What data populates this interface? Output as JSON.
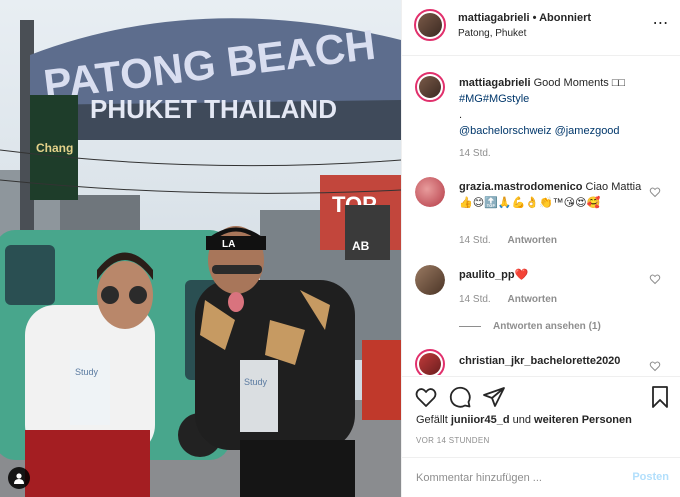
{
  "photo": {
    "sign_line1": "PATONG BEACH",
    "sign_line2": "PHUKET THAILAND",
    "chang_label": "Chang",
    "billboard_letters": "TOP",
    "billboard_sub": "AB",
    "cup_left_text": "Study",
    "cup_right_text": "Study",
    "cap_logo": "LA"
  },
  "header": {
    "username": "mattiagabrieli",
    "separator": "•",
    "follow_state": "Abonniert",
    "location": "Patong, Phuket",
    "more_icon": "⋯"
  },
  "caption": {
    "username": "mattiagabrieli",
    "text": "Good Moments □□",
    "hashtags": "#MG#MGstyle",
    "dot": ".",
    "mention1": "@bachelorschweiz",
    "mention2": "@jamezgood",
    "time": "14 Std."
  },
  "comments": [
    {
      "username": "grazia.mastrodomenico",
      "text": "Ciao Mattia 👍😊🔝🙏💪👌👏™😘😍🥰",
      "time": "14 Std.",
      "reply": "Antworten"
    },
    {
      "username": "paulito_pp",
      "text": "❤️",
      "time": "14 Std.",
      "reply": "Antworten",
      "view_replies": "Antworten ansehen (1)"
    },
    {
      "username": "christian_jkr_bachelorette2020",
      "text": "",
      "time": "",
      "reply": ""
    }
  ],
  "likes": {
    "prefix": "Gefällt",
    "user": "juniior45_d",
    "middle": "und",
    "others": "weiteren Personen"
  },
  "timestamp": "VOR 14 STUNDEN",
  "add_comment": {
    "placeholder": "Kommentar hinzufügen ...",
    "post_label": "Posten"
  },
  "colors": {
    "link": "#00376b",
    "post_disabled": "#b2dffc",
    "muted": "#8e8e8e",
    "story_ring": "#e1306c"
  }
}
